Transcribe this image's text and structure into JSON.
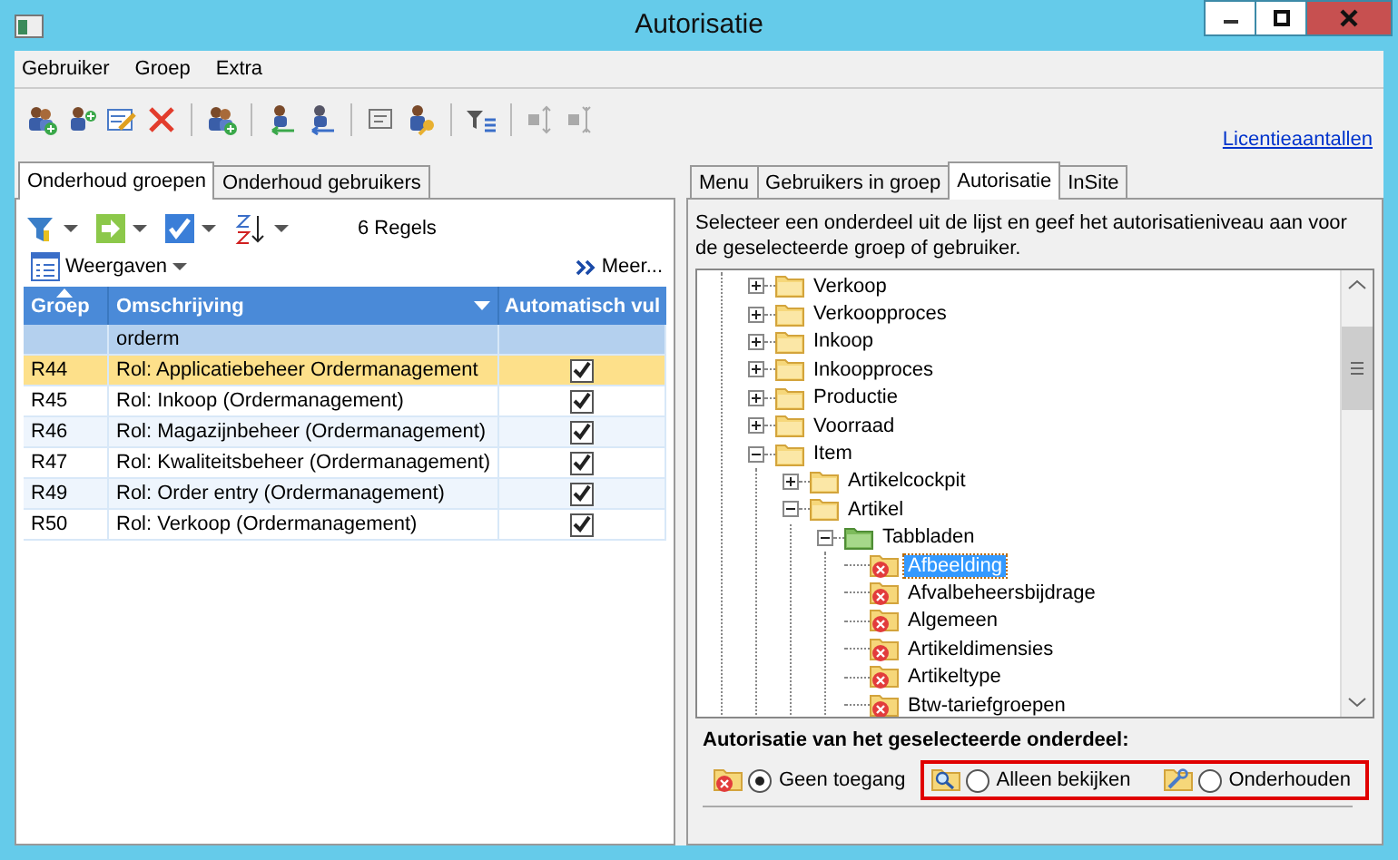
{
  "window": {
    "title": "Autorisatie"
  },
  "menu": [
    "Gebruiker",
    "Groep",
    "Extra"
  ],
  "license_link": "Licentieaantallen",
  "left_tabs": [
    {
      "label": "Onderhoud groepen",
      "selected": true
    },
    {
      "label": "Onderhoud gebruikers",
      "selected": false
    }
  ],
  "row_count": "6 Regels",
  "views_button": "Weergaven",
  "more_button": "Meer...",
  "table": {
    "columns": [
      {
        "label": "Groep",
        "sorted": true,
        "dropdown": false
      },
      {
        "label": "Omschrijving",
        "sorted": false,
        "dropdown": true
      },
      {
        "label": "Automatisch vul",
        "sorted": false,
        "dropdown": false
      }
    ],
    "filter": "orderm",
    "rows": [
      {
        "group": "R44",
        "description": "Rol: Applicatiebeheer Ordermanagement",
        "checked": true,
        "selected": true
      },
      {
        "group": "R45",
        "description": "Rol: Inkoop (Ordermanagement)",
        "checked": true,
        "selected": false
      },
      {
        "group": "R46",
        "description": "Rol: Magazijnbeheer (Ordermanagement)",
        "checked": true,
        "selected": false
      },
      {
        "group": "R47",
        "description": "Rol: Kwaliteitsbeheer (Ordermanagement)",
        "checked": true,
        "selected": false
      },
      {
        "group": "R49",
        "description": "Rol: Order entry (Ordermanagement)",
        "checked": true,
        "selected": false
      },
      {
        "group": "R50",
        "description": "Rol: Verkoop (Ordermanagement)",
        "checked": true,
        "selected": false
      }
    ]
  },
  "right_tabs": [
    {
      "label": "Menu",
      "selected": false
    },
    {
      "label": "Gebruikers in groep",
      "selected": false
    },
    {
      "label": "Autorisatie",
      "selected": true
    },
    {
      "label": "InSite",
      "selected": false
    }
  ],
  "instruction": "Selecteer een onderdeel uit de lijst en geef het autorisatieniveau aan voor de geselecteerde groep of gebruiker.",
  "tree": [
    {
      "label": "Verkoop",
      "kind": "folder",
      "expanded": false,
      "selected": false
    },
    {
      "label": "Verkoopproces",
      "kind": "folder",
      "expanded": false,
      "selected": false
    },
    {
      "label": "Inkoop",
      "kind": "folder",
      "expanded": false,
      "selected": false
    },
    {
      "label": "Inkoopproces",
      "kind": "folder",
      "expanded": false,
      "selected": false
    },
    {
      "label": "Productie",
      "kind": "folder",
      "expanded": false,
      "selected": false
    },
    {
      "label": "Voorraad",
      "kind": "folder",
      "expanded": false,
      "selected": false
    },
    {
      "label": "Item",
      "kind": "folder",
      "expanded": true,
      "selected": false,
      "children": [
        {
          "label": "Artikelcockpit",
          "kind": "folder",
          "expanded": false,
          "selected": false
        },
        {
          "label": "Artikel",
          "kind": "folder",
          "expanded": true,
          "selected": false,
          "children": [
            {
              "label": "Tabbladen",
              "kind": "tabs",
              "expanded": true,
              "selected": false,
              "children": [
                {
                  "label": "Afbeelding",
                  "kind": "denied",
                  "selected": true
                },
                {
                  "label": "Afvalbeheersbijdrage",
                  "kind": "denied",
                  "selected": false
                },
                {
                  "label": "Algemeen",
                  "kind": "denied",
                  "selected": false
                },
                {
                  "label": "Artikeldimensies",
                  "kind": "denied",
                  "selected": false
                },
                {
                  "label": "Artikeltype",
                  "kind": "denied",
                  "selected": false
                },
                {
                  "label": "Btw-tariefgroepen",
                  "kind": "denied",
                  "selected": false
                }
              ]
            }
          ]
        }
      ]
    }
  ],
  "access": {
    "title": "Autorisatie van het geselecteerde onderdeel:",
    "options": [
      {
        "label": "Geen toegang",
        "kind": "denied",
        "selected": true,
        "highlighted": false
      },
      {
        "label": "Alleen bekijken",
        "kind": "view",
        "selected": false,
        "highlighted": true
      },
      {
        "label": "Onderhouden",
        "kind": "edit",
        "selected": false,
        "highlighted": true
      }
    ]
  }
}
